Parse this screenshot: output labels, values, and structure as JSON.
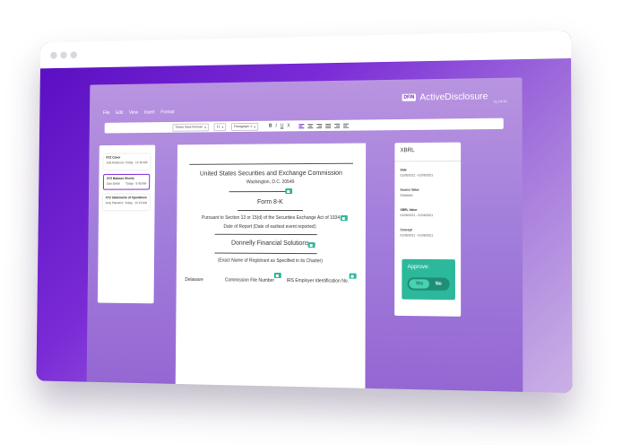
{
  "app": {
    "brand_prefix": "DFIN",
    "brand_name": "ActiveDisclosure",
    "brand_sub": "by DFIN",
    "menu": [
      "File",
      "Edit",
      "View",
      "Insert",
      "Format"
    ],
    "toolbar": {
      "font": "Times New Roman",
      "size": "11",
      "style": "Paragraph 1",
      "bold": "B",
      "italic": "I",
      "underline": "U",
      "strike": "X"
    }
  },
  "left_panel": {
    "cards": [
      {
        "title": "XYZ Cover",
        "author": "Jodi Anderson",
        "time": "Today - 11:36 AM"
      },
      {
        "title": "XYZ Balance Sheets",
        "author": "Dan Smith",
        "time": "Today - 9:45 AM"
      },
      {
        "title": "XYZ Statements of Operations",
        "author": "Amy Flanders",
        "time": "Today - 10:23 AM"
      }
    ]
  },
  "document": {
    "header": "United States Securities and Exchange Commission",
    "location": "Washington, D.C. 20549",
    "form": "Form 8-K",
    "pursuant": "Pursuant to Section 13 or 15(d) of the Securities Exchange Act of 1934",
    "date_report": "Date of Report (Date of earliest event reported):",
    "company": "Donnelly Financial Solutions",
    "exact_name": "(Exact Name of Registrant as Specified in its Charter)",
    "state": "Delaware",
    "commission": "Commission File Number",
    "irs": "IRS Employer Identification No."
  },
  "xbrl": {
    "title": "XBRL",
    "fields": [
      {
        "label": "Date",
        "value": "01/06/2021 - 01/06/2021"
      },
      {
        "label": "Source Value",
        "value": "Delaware"
      },
      {
        "label": "XBRL Value",
        "value": "01/06/2021 - 01/06/2021"
      },
      {
        "label": "Concept",
        "value": "01/06/2021 - 01/06/2021"
      }
    ]
  },
  "approve": {
    "title": "Approve:",
    "yes": "Yes",
    "no": "No",
    "selected": "Yes"
  },
  "colors": {
    "purple": "#6d21c8",
    "teal": "#2bb89b"
  }
}
